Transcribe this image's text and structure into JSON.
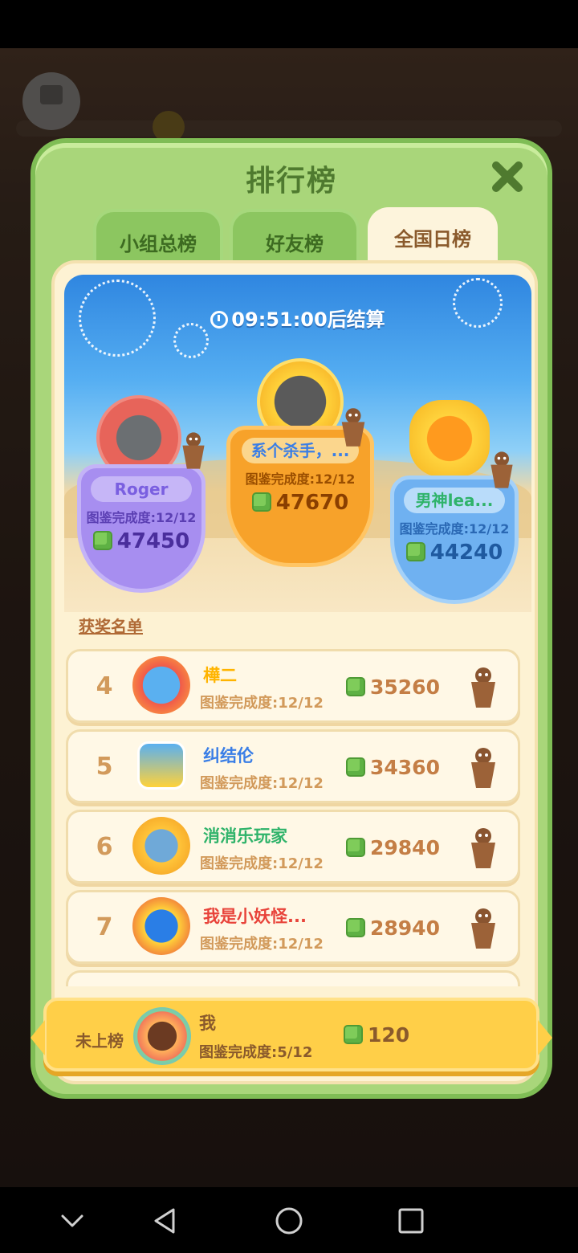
{
  "panel": {
    "title": "排行榜",
    "tabs": [
      {
        "label": "小组总榜",
        "active": false
      },
      {
        "label": "好友榜",
        "active": false
      },
      {
        "label": "全国日榜",
        "active": true
      }
    ]
  },
  "podium": {
    "timer_text": "09:51:00后结算",
    "players": [
      {
        "rank": 2,
        "name": "Roger",
        "completion": "图鉴完成度:12/12",
        "score": "47450"
      },
      {
        "rank": 1,
        "name": "系个杀手，...",
        "completion": "图鉴完成度:12/12",
        "score": "47670"
      },
      {
        "rank": 3,
        "name": "男神lea...",
        "completion": "图鉴完成度:12/12",
        "score": "44240"
      }
    ]
  },
  "award_list_title": "获奖名单",
  "rankings": [
    {
      "rank": "4",
      "name": "樺二",
      "completion": "图鉴完成度:12/12",
      "score": "35260",
      "name_color": "#ffb400"
    },
    {
      "rank": "5",
      "name": "纠结伦",
      "completion": "图鉴完成度:12/12",
      "score": "34360",
      "name_color": "#3a7ee6"
    },
    {
      "rank": "6",
      "name": "消消乐玩家",
      "completion": "图鉴完成度:12/12",
      "score": "29840",
      "name_color": "#2fb36a"
    },
    {
      "rank": "7",
      "name": "我是小妖怪...",
      "completion": "图鉴完成度:12/12",
      "score": "28940",
      "name_color": "#e8433a"
    }
  ],
  "me": {
    "rank_text": "未上榜",
    "name": "我",
    "completion": "图鉴完成度:5/12",
    "score": "120"
  },
  "colors": {
    "panel_green": "#a9d67a",
    "inner_cream": "#fdf2d3",
    "me_bar_yellow": "#ffcf48"
  }
}
